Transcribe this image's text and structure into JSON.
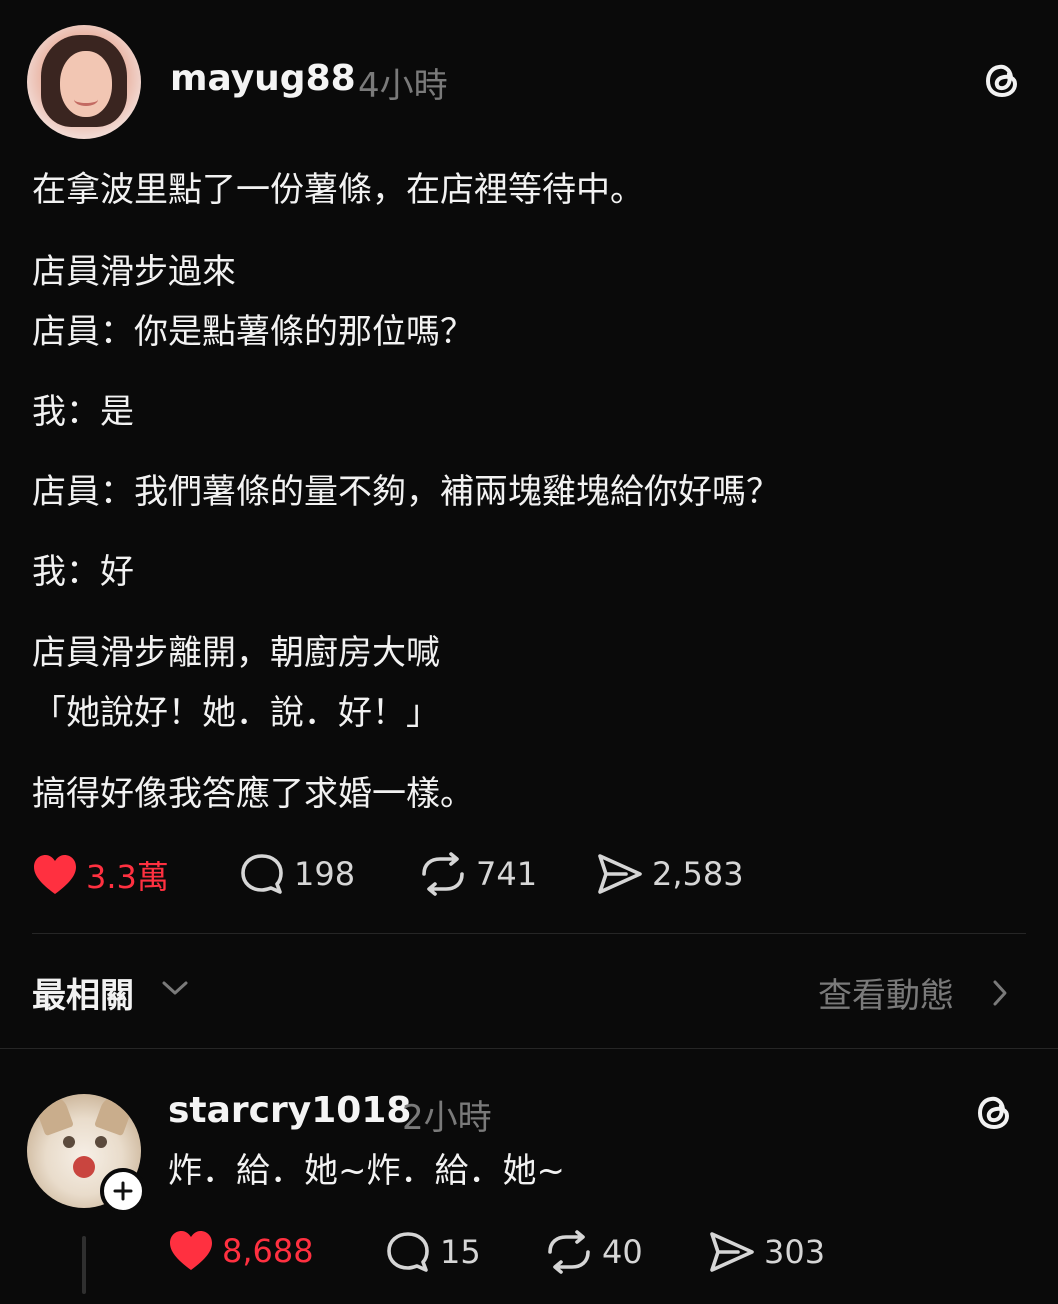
{
  "post": {
    "username": "mayug88",
    "time": "4小時",
    "body": [
      "在拿波里點了一份薯條，在店裡等待中。",
      "店員滑步過來",
      "店員：你是點薯條的那位嗎？",
      "我：是",
      "店員：我們薯條的量不夠，補兩塊雞塊給你好嗎？",
      "我：好",
      "店員滑步離開，朝廚房大喊",
      "「她說好！她．說．好！」",
      "搞得好像我答應了求婚一樣。"
    ],
    "stats": {
      "likes": "3.3萬",
      "replies": "198",
      "reposts": "741",
      "shares": "2,583"
    }
  },
  "sort": {
    "label": "最相關",
    "activity_link": "查看動態"
  },
  "reply": {
    "username": "starcry1018",
    "time": "2小時",
    "text": "炸．給．她~炸．給．她~",
    "stats": {
      "likes": "8,688",
      "replies": "15",
      "reposts": "40",
      "shares": "303"
    }
  },
  "colors": {
    "background": "#0a0a0a",
    "like_red": "#ff3040",
    "muted_text": "#7a7a7a"
  },
  "icons": [
    "threads-icon",
    "heart-icon",
    "comment-icon",
    "repost-icon",
    "share-icon",
    "chevron-down-icon",
    "chevron-right-icon",
    "plus-icon"
  ]
}
